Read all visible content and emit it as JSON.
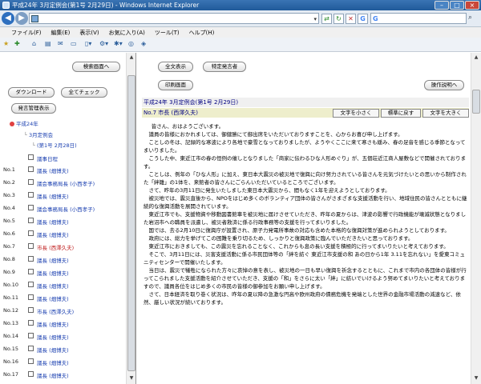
{
  "window": {
    "title": "平成24年 3月定例会(第1号 2月29日) - Windows Internet Explorer"
  },
  "addressbar": {
    "url": "",
    "search_value": ""
  },
  "menu": [
    "ファイル(F)",
    "編集(E)",
    "表示(V)",
    "お気に入り(A)",
    "ツール(T)",
    "ヘルプ(H)"
  ],
  "left": {
    "btn_search": "検索画面へ",
    "btn_download": "ダウンロード",
    "btn_check_all": "全てチェック",
    "btn_speakers": "発言管理表示",
    "tree": {
      "year": "平成24年",
      "session": "3月定例会",
      "day": "(第1号 2月28日)"
    },
    "items": [
      {
        "no": "",
        "label": "議事日程"
      },
      {
        "no": "No.1",
        "label": "議長 (畑博夫)"
      },
      {
        "no": "No.2",
        "label": "議会事務局長 (小西孝子)"
      },
      {
        "no": "No.3",
        "label": "議長 (畑博夫)"
      },
      {
        "no": "No.4",
        "label": "議会事務局長 (小西孝子)"
      },
      {
        "no": "No.5",
        "label": "議長 (畑博夫)"
      },
      {
        "no": "No.6",
        "label": "議長 (畑博夫)"
      },
      {
        "no": "No.7",
        "label": "市長 (西澤久夫)"
      },
      {
        "no": "No.8",
        "label": "議長 (畑博夫)"
      },
      {
        "no": "No.9",
        "label": "議長 (畑博夫)"
      },
      {
        "no": "No.10",
        "label": "議長 (畑博夫)"
      },
      {
        "no": "No.11",
        "label": "議長 (畑博夫)"
      },
      {
        "no": "No.12",
        "label": "市長 (西澤久夫)"
      },
      {
        "no": "No.13",
        "label": "議長 (畑博夫)"
      },
      {
        "no": "No.14",
        "label": "議長 (畑博夫)"
      },
      {
        "no": "No.15",
        "label": "議長 (畑博夫)"
      },
      {
        "no": "No.16",
        "label": "議長 (畑博夫)"
      },
      {
        "no": "No.17",
        "label": "議長 (畑博夫)"
      }
    ]
  },
  "right": {
    "btn_show_all": "全文表示",
    "btn_specific": "特定発言者",
    "btn_print": "印刷画面",
    "btn_help": "操作説明へ",
    "header": "平成24年 3月定例会(第1号 2月29日)",
    "speech_title": "No.7 市長 (西澤久夫)",
    "btn_smaller": "文字を小さく",
    "btn_reset": "標準に戻す",
    "btn_larger": "文字を大きく",
    "paragraphs": [
      "皆さん、おはようございます。",
      "議員の皆様におかれましては、御健勝にて御出席をいただいておりますことを、心からお喜び申し上げます。",
      "ことしの冬は、記録的な寒波により各地で豪雪となっておりましたが、ようやくここに来て寒さも緩み、春の足音を感じる季節となってまいりました。",
      "こうした中、東近江市の春の恒例の催しとなりました「商家に伝わるひな人形めぐり」が、五個荘近江商人屋敷などで開催されております。",
      "ことしは、例年の「ひな人形」に加え、東日本大震災の被災地で復興に向け努力されている皆さんを元気づけたいとの思いから制作された「絆雛」の1体を、来館者の皆さんにごらんいただいているところでございます。",
      "さて、昨年の3月11日に発生いたしました東日本大震災から、間もなく1年を迎えようとしております。",
      "被災地では、震災直後から、NPOをはじめ多くのボランティア団体の皆さんがさまざまな支援活動を行い、地域住民の皆さんとともに継続的な復興活動を展開されています。",
      "東近江市でも、支援物資や移動図書館車を被災地に届けさせていただき、昨年の夏からは、津波の影響で行政機能が壊滅状態となりました岩沼市への職員を派遣し、被災者救済に係る行政事務等の支援を行ってまいりました。",
      "国では、去る2月10日に復興庁が設置され、原子力発電所事故の対応も含めた本格的な復興対策が進められようとしております。",
      "政府には、総力を挙げてこの困難を乗り切るため、しっかりと復興政策に臨んでいただきたいと思っております。",
      "東近江市におきましても、この震災を忘れることなく、これからも息の長い支援を積極的に行ってまいりたいと考えております。",
      "そこで、3月11日には、災害支援活動に係る市民団体等の「絆を紡ぐ 東近江市支援の和 あの日から1年 3.11を忘れない」を愛東コミュニティセンターで開催いたします。",
      "当日は、震災で犠牲になられた方々に哀悼の意を表し、被災地の一日も早い復興を祈念するとともに、これまで市内の各団体の皆様が行ってこられました支援活動を紹介させていただき、支援の「和」をさらに太い「絆」に紡いでいけるよう努めてまいりたいと考えておりますので、議員各位をはじめ多くの市民の皆様の御参加をお願い申し上げます。",
      "さて、日本経済を取り巻く状況は、昨年の夏以降の急激な円高や欧州政府の債務危機を発端とした世界の金融市場活動の減速など、依然、厳しい状況が続いております。"
    ]
  }
}
